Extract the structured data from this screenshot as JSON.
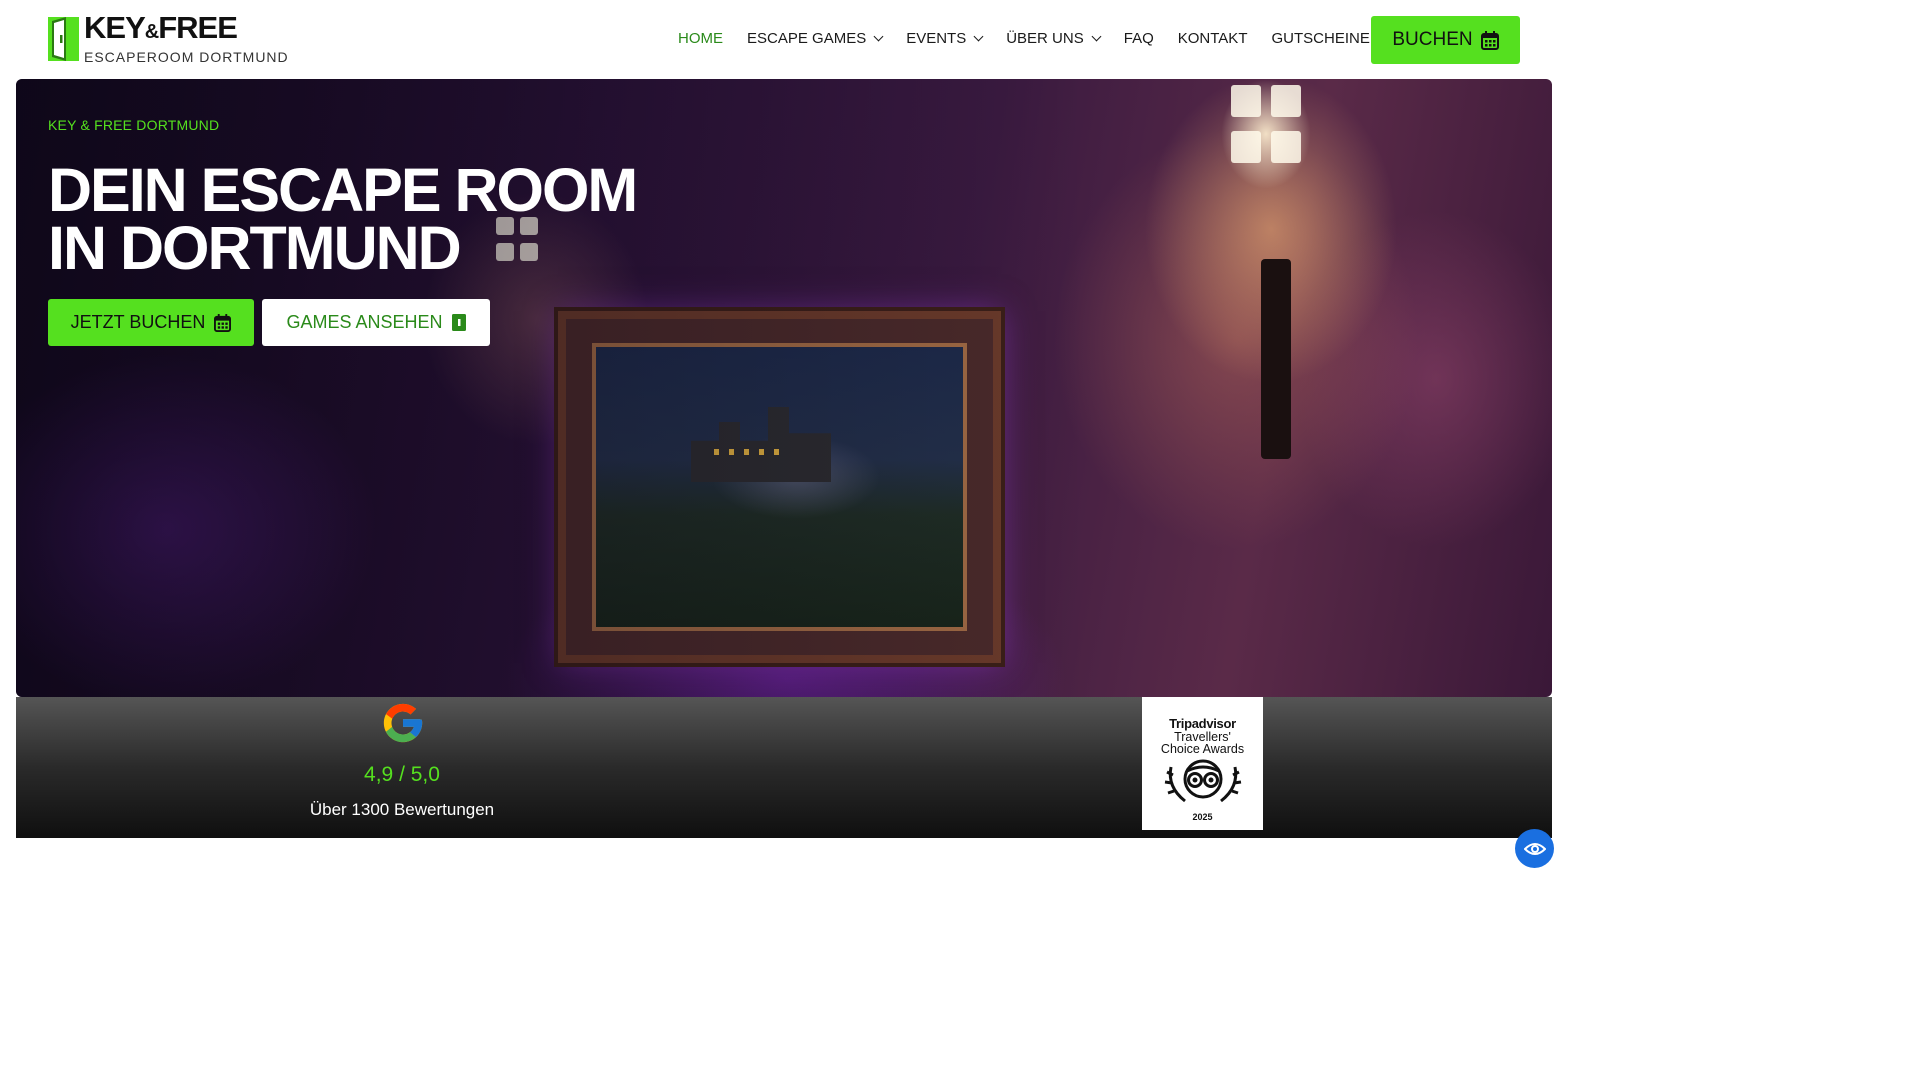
{
  "brand": {
    "name_part1": "KEY",
    "name_amp": "&",
    "name_part2": "FREE",
    "subtitle": "ESCAPEROOM DORTMUND",
    "accent_color": "#55e01f"
  },
  "nav": {
    "items": [
      {
        "label": "HOME",
        "active": true,
        "dropdown": false
      },
      {
        "label": "ESCAPE GAMES",
        "active": false,
        "dropdown": true
      },
      {
        "label": "EVENTS",
        "active": false,
        "dropdown": true
      },
      {
        "label": "ÜBER UNS",
        "active": false,
        "dropdown": true
      },
      {
        "label": "FAQ",
        "active": false,
        "dropdown": false
      },
      {
        "label": "KONTAKT",
        "active": false,
        "dropdown": false
      },
      {
        "label": "GUTSCHEINE",
        "active": false,
        "dropdown": false
      }
    ],
    "book_label": "BUCHEN",
    "book_icon": "calendar-icon"
  },
  "hero": {
    "eyebrow": "KEY & FREE DORTMUND",
    "headline_line1": "DEIN ESCAPE ROOM",
    "headline_line2": "IN DORTMUND",
    "cta_primary": "JETZT BUCHEN",
    "cta_primary_icon": "calendar-icon",
    "cta_secondary": "GAMES ANSEHEN",
    "cta_secondary_icon": "door-icon"
  },
  "reviews": {
    "google_icon": "google-icon",
    "rating": "4,9 / 5,0",
    "count_text": "Über 1300 Bewertungen",
    "tripadvisor": {
      "line1": "Tripadvisor",
      "line2": "Travellers'",
      "line3": "Choice Awards",
      "year": "2025"
    }
  },
  "accessibility": {
    "icon": "eye-icon"
  }
}
